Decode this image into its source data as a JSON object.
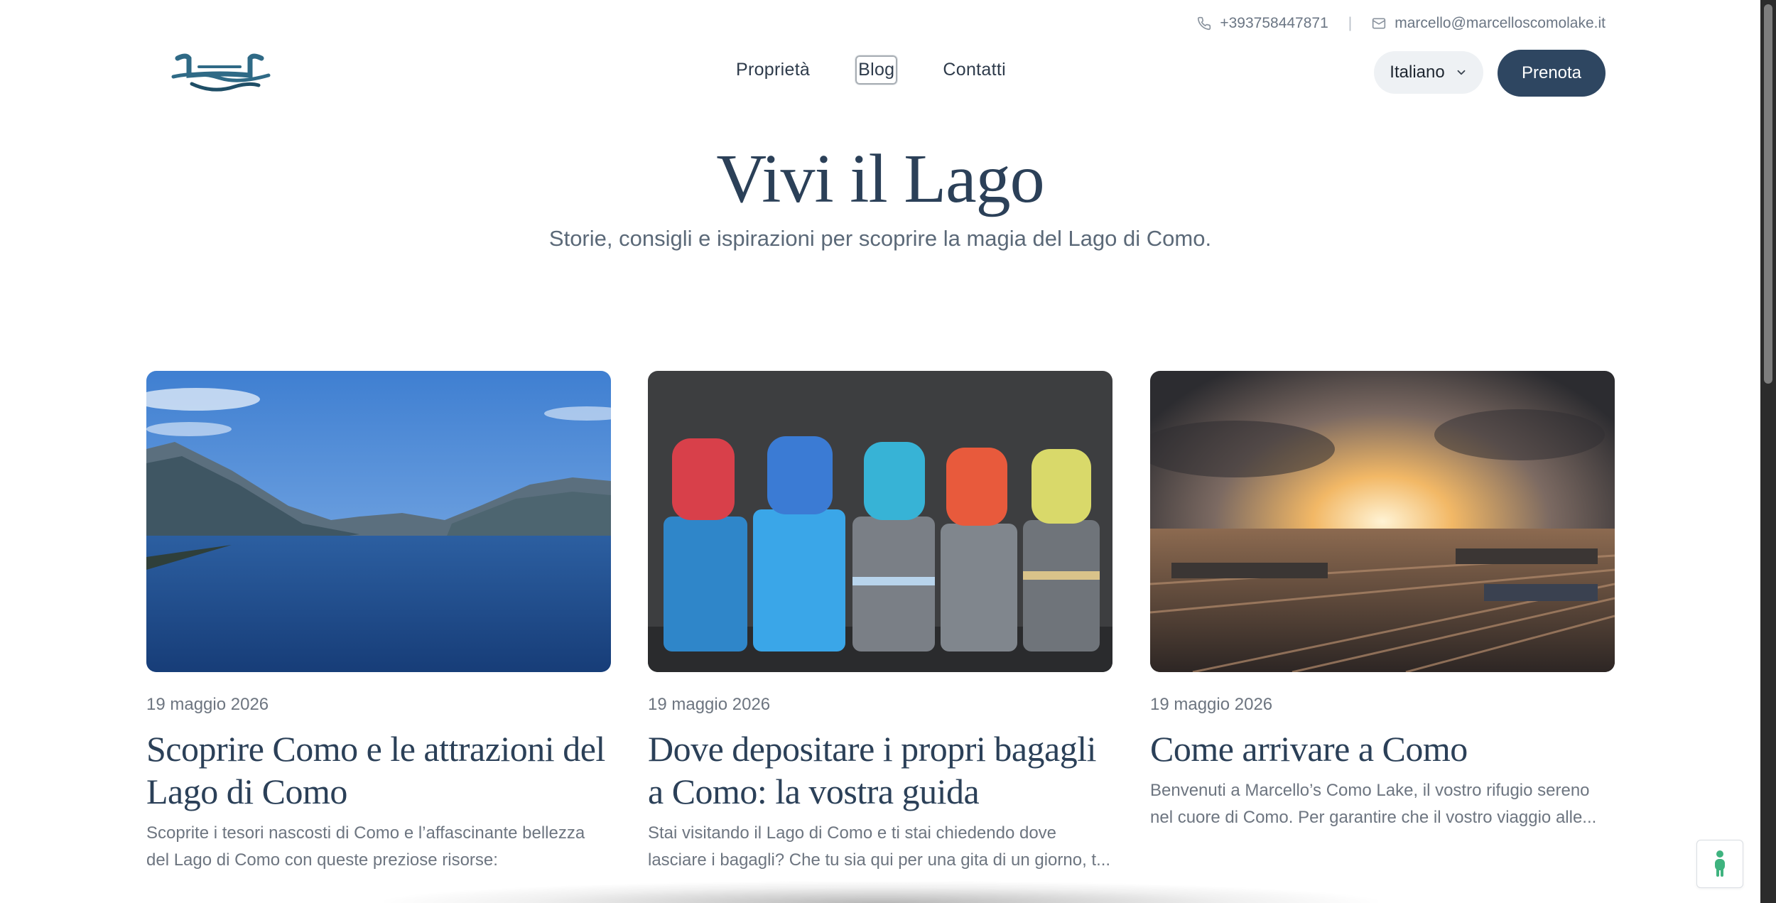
{
  "topbar": {
    "phone": "+393758447871",
    "separator": "|",
    "email": "marcello@marcelloscomolake.it",
    "phone_icon": "phone-icon",
    "email_icon": "mail-icon"
  },
  "header": {
    "logo_icon": "lake-logo-icon",
    "nav": [
      {
        "label": "Proprietà"
      },
      {
        "label": "Blog",
        "active": true
      },
      {
        "label": "Contatti"
      }
    ],
    "language": "Italiano",
    "language_icon": "chevron-down-icon",
    "cta_label": "Prenota"
  },
  "hero": {
    "title": "Vivi il Lago",
    "subtitle": "Storie, consigli e ispirazioni per scoprire la magia del Lago di Como."
  },
  "posts": [
    {
      "date": "19 maggio 2026",
      "title": "Scoprire Como e le attrazioni del Lago di Como",
      "excerpt": "Scoprite i tesori nascosti di Como e l’affascinante bellezza del Lago di Como con queste preziose risorse:",
      "image": "lake-photo"
    },
    {
      "date": "19 maggio 2026",
      "title": "Dove depositare i propri bagagli a Como: la vostra guida",
      "excerpt": "Stai visitando il Lago di Como e ti stai chiedendo dove lasciare i bagagli? Che tu sia qui per una gita di un giorno, t...",
      "image": "luggage-photo"
    },
    {
      "date": "19 maggio 2026",
      "title": "Come arrivare a Como",
      "excerpt": "Benvenuti a Marcello’s Como Lake, il vostro rifugio sereno nel cuore di Como. Per garantire che il vostro viaggio alle...",
      "image": "railway-sunset-photo"
    }
  ],
  "widget": {
    "icon": "accessibility-icon"
  },
  "colors": {
    "primary": "#2e4661",
    "heading": "#2b4058",
    "muted": "#6d7580",
    "accent_green": "#3fb37f"
  }
}
